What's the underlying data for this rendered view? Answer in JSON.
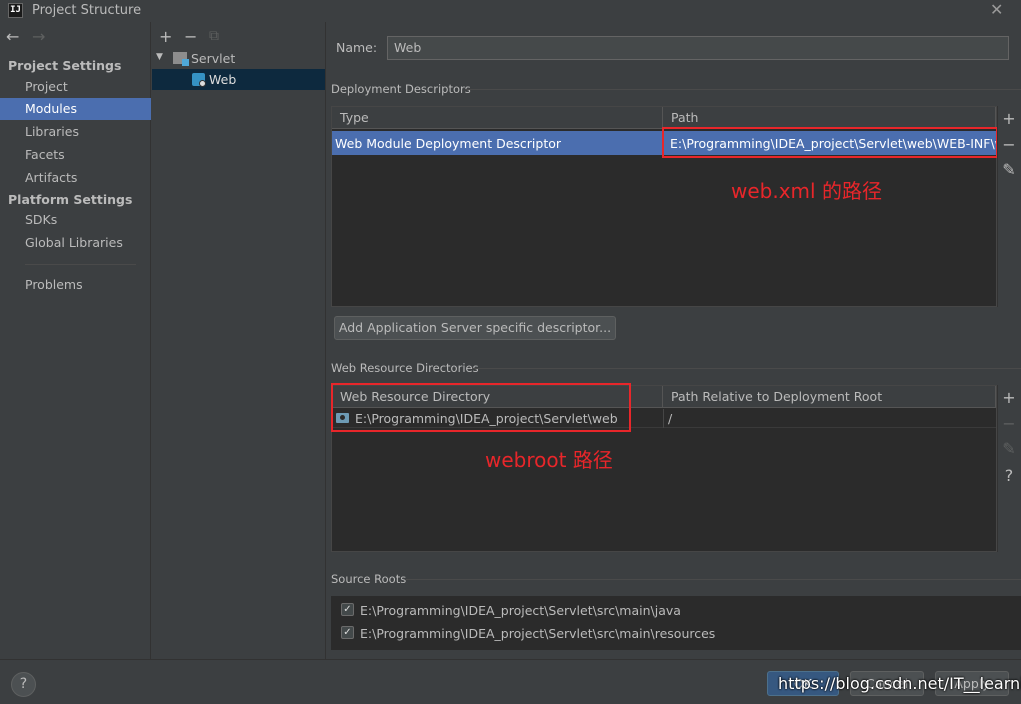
{
  "window": {
    "title": "Project Structure",
    "app_icon_text": "IJ",
    "close_glyph": "✕"
  },
  "nav": {
    "back_glyph": "←",
    "forward_glyph": "→",
    "project_settings_header": "Project Settings",
    "project_settings_items": [
      "Project",
      "Modules",
      "Libraries",
      "Facets",
      "Artifacts"
    ],
    "platform_settings_header": "Platform Settings",
    "platform_settings_items": [
      "SDKs",
      "Global Libraries"
    ],
    "problems": "Problems",
    "selected": "Modules"
  },
  "tree": {
    "toolbar": {
      "add": "+",
      "remove": "−",
      "copy": "⧉"
    },
    "expand_glyph": "▼",
    "root": "Servlet",
    "child": "Web"
  },
  "details": {
    "name_label": "Name:",
    "name_value": "Web",
    "deployment_descriptors": {
      "section_title": "Deployment Descriptors",
      "columns": [
        "Type",
        "Path"
      ],
      "rows": [
        {
          "type": "Web Module Deployment Descriptor",
          "path": "E:\\Programming\\IDEA_project\\Servlet\\web\\WEB-INF\\we"
        }
      ],
      "side_buttons": [
        "+",
        "−",
        "✎"
      ],
      "add_button": "Add Application Server specific descriptor..."
    },
    "web_resource_directories": {
      "section_title": "Web Resource Directories",
      "columns": [
        "Web Resource Directory",
        "Path Relative to Deployment Root"
      ],
      "rows": [
        {
          "directory": "E:\\Programming\\IDEA_project\\Servlet\\web",
          "relative": "/"
        }
      ],
      "side_buttons": [
        "+",
        "−",
        "✎",
        "?"
      ]
    },
    "source_roots": {
      "section_title": "Source Roots",
      "items": [
        {
          "checked": true,
          "path": "E:\\Programming\\IDEA_project\\Servlet\\src\\main\\java"
        },
        {
          "checked": true,
          "path": "E:\\Programming\\IDEA_project\\Servlet\\src\\main\\resources"
        }
      ],
      "check_glyph": "✓"
    }
  },
  "annotations": {
    "descriptor_note": "web.xml 的路径",
    "webroot_note": "webroot 路径"
  },
  "footer": {
    "help": "?",
    "ok": "OK",
    "cancel": "Cancel",
    "apply": "Apply",
    "watermark": "https://blog.csdn.net/IT__learning"
  },
  "colors": {
    "selection": "#4b6eaf",
    "annotation": "#e8262a",
    "background": "#3c3f41",
    "table": "#2b2b2b"
  }
}
